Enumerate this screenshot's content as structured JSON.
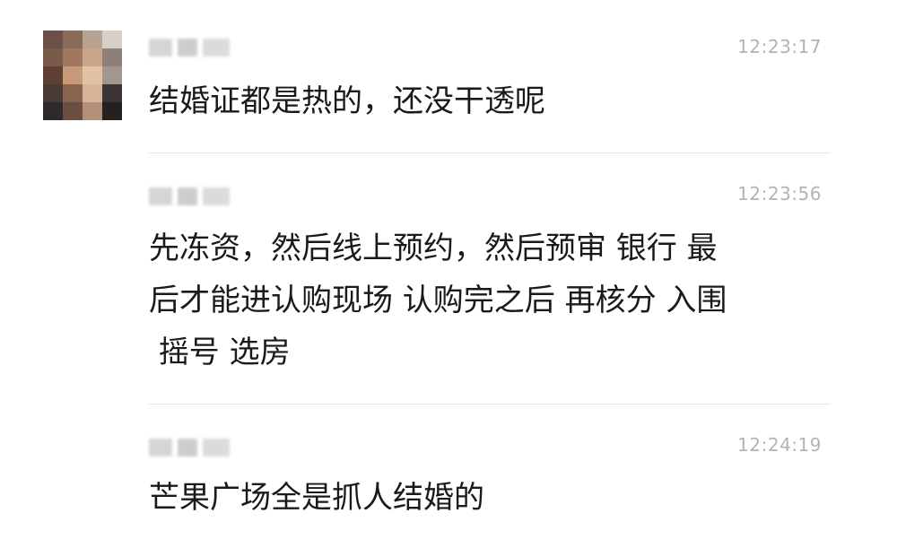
{
  "messages": [
    {
      "time": "12:23:17",
      "text": "结婚证都是热的，还没干透呢"
    },
    {
      "time": "12:23:56",
      "text": "先冻资，然后线上预约，然后预审 银行 最\n后才能进认购现场 认购完之后 再核分 入围\n 摇号 选房"
    },
    {
      "time": "12:24:19",
      "text": "芒果广场全是抓人结婚的"
    }
  ]
}
